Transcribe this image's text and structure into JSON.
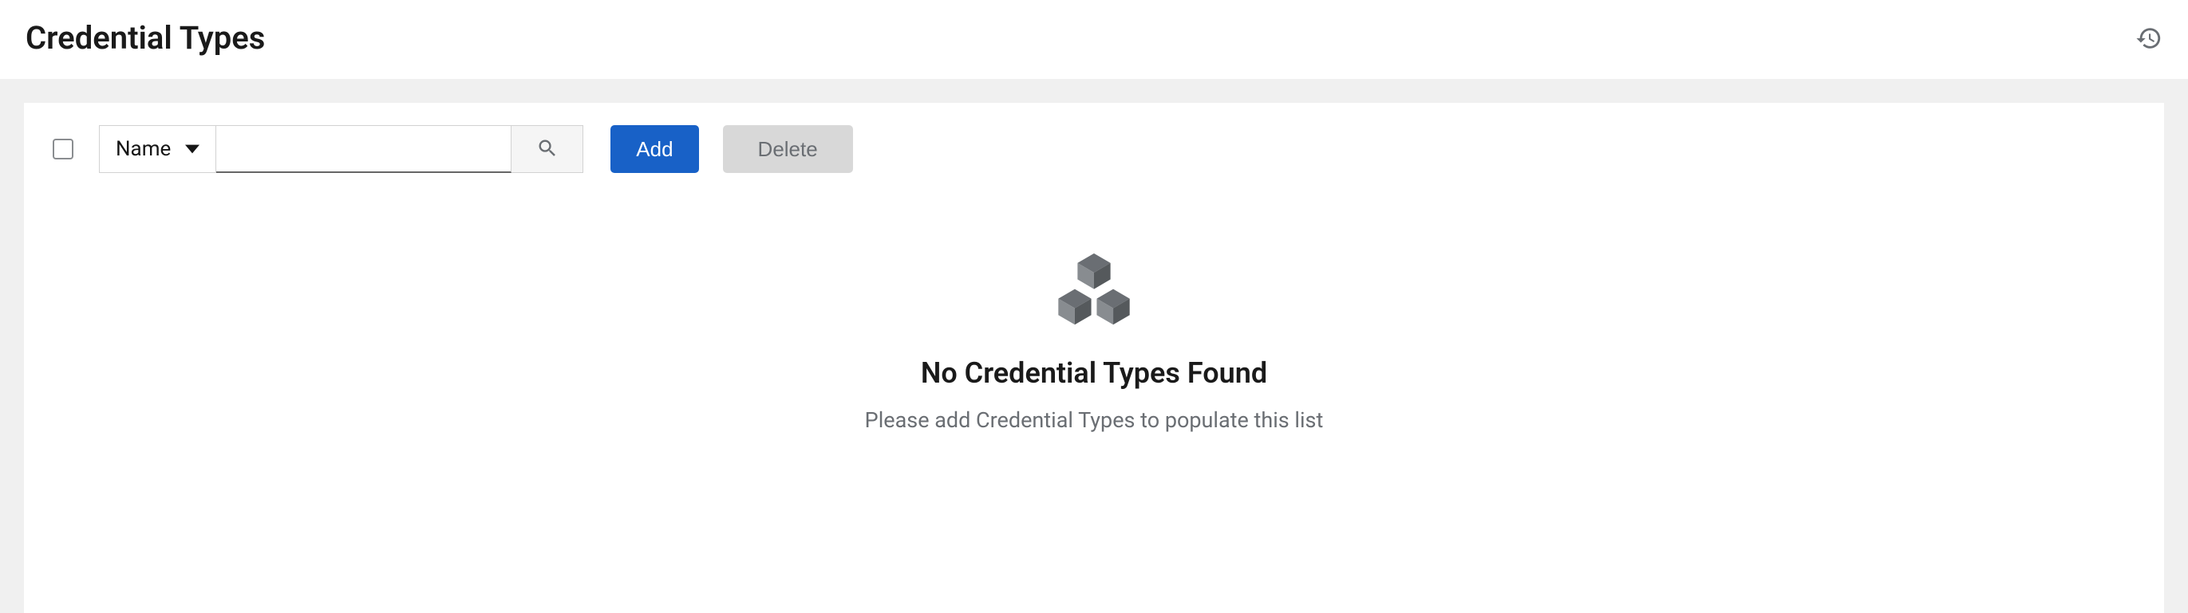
{
  "header": {
    "title": "Credential Types"
  },
  "toolbar": {
    "filter_field": "Name",
    "search_value": "",
    "add_label": "Add",
    "delete_label": "Delete"
  },
  "empty_state": {
    "title": "No Credential Types Found",
    "description": "Please add Credential Types to populate this list"
  }
}
